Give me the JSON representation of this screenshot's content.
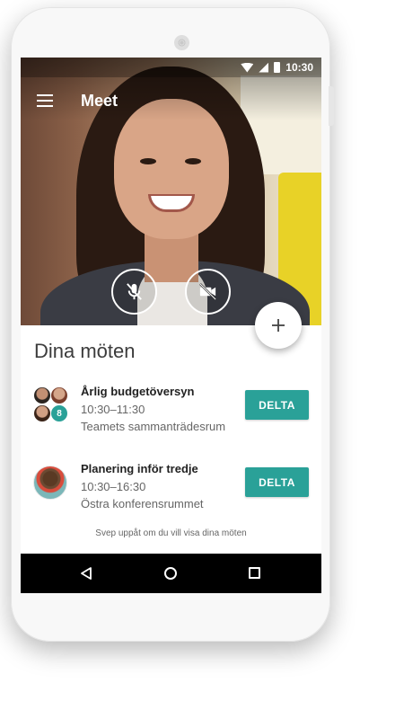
{
  "status_bar": {
    "time": "10:30"
  },
  "app_bar": {
    "title": "Meet"
  },
  "call_controls": {
    "mic": "mic-off-icon",
    "camera": "video-off-icon"
  },
  "section": {
    "title": "Dina möten"
  },
  "meetings": [
    {
      "title": "Årlig budgetöversyn",
      "time": "10:30–11:30",
      "room": "Teamets sammanträdesrum",
      "extra_participants": "8",
      "join_label": "DELTA"
    },
    {
      "title": "Planering inför tredje",
      "time": "10:30–16:30",
      "room": "Östra konferensrummet",
      "join_label": "DELTA"
    }
  ],
  "hint": "Svep uppåt om du vill visa dina möten",
  "colors": {
    "accent": "#2aa198",
    "nav_bar": "#000000"
  }
}
